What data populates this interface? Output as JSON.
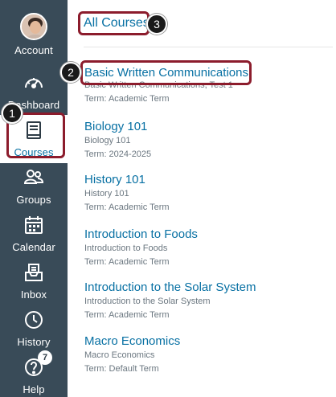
{
  "sidebar": {
    "items": [
      {
        "label": "Account",
        "icon": "avatar"
      },
      {
        "label": "Dashboard",
        "icon": "dashboard-icon"
      },
      {
        "label": "Courses",
        "icon": "courses-icon",
        "active": true
      },
      {
        "label": "Groups",
        "icon": "groups-icon"
      },
      {
        "label": "Calendar",
        "icon": "calendar-icon"
      },
      {
        "label": "Inbox",
        "icon": "inbox-icon"
      },
      {
        "label": "History",
        "icon": "history-icon"
      },
      {
        "label": "Help",
        "icon": "help-icon",
        "badge": "7"
      }
    ]
  },
  "main": {
    "all_courses_label": "All Courses",
    "courses": [
      {
        "name": "Basic Written Communications",
        "subtitle": "Basic Written Communications, Test 1",
        "term": "Term: Academic Term"
      },
      {
        "name": "Biology 101",
        "subtitle": "Biology 101",
        "term": "Term: 2024-2025"
      },
      {
        "name": "History 101",
        "subtitle": "History 101",
        "term": "Term: Academic Term"
      },
      {
        "name": "Introduction to Foods",
        "subtitle": "Introduction to Foods",
        "term": "Term: Academic Term"
      },
      {
        "name": "Introduction to the Solar System",
        "subtitle": "Introduction to the Solar System",
        "term": "Term: Academic Term"
      },
      {
        "name": "Macro Economics",
        "subtitle": "Macro Economics",
        "term": "Term: Default Term"
      }
    ]
  },
  "callouts": [
    "1",
    "2",
    "3"
  ],
  "colors": {
    "sidebar_bg": "#394b58",
    "link": "#0770a3",
    "highlight": "#8c1c2c"
  }
}
